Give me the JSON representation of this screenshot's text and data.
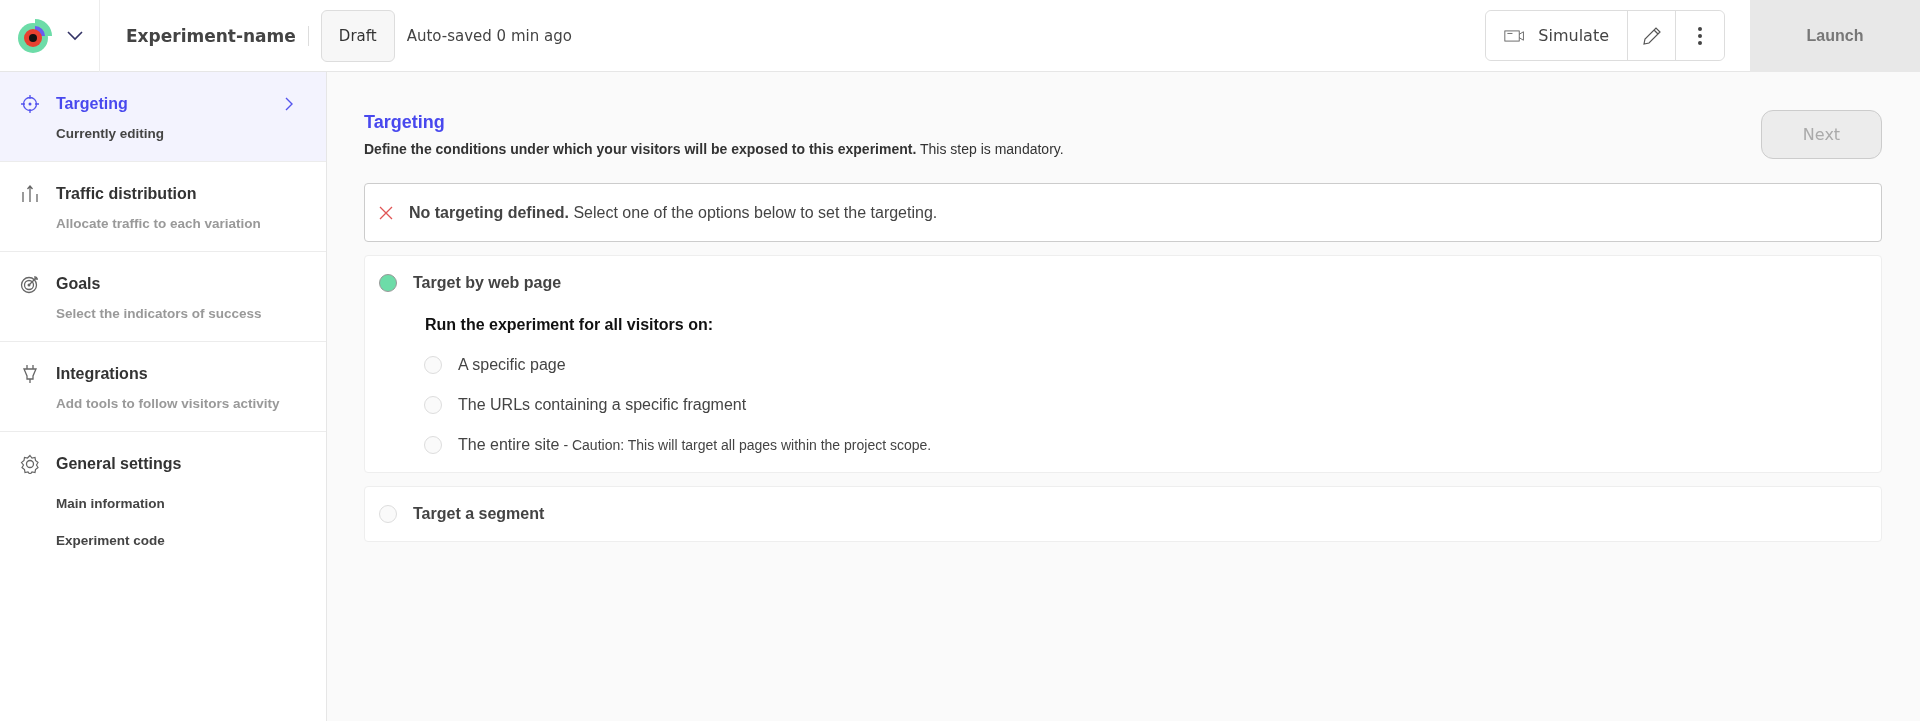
{
  "header": {
    "experiment_name": "Experiment-name",
    "status": "Draft",
    "autosave": "Auto-saved 0 min ago",
    "simulate": "Simulate",
    "launch": "Launch"
  },
  "sidebar": {
    "items": [
      {
        "kind": "targeting",
        "title": "Targeting",
        "subtitle": "Currently editing",
        "selected": true
      },
      {
        "kind": "traffic",
        "title": "Traffic distribution",
        "subtitle": "Allocate traffic to each variation",
        "selected": false
      },
      {
        "kind": "goals",
        "title": "Goals",
        "subtitle": "Select the indicators of success",
        "selected": false
      },
      {
        "kind": "integrations",
        "title": "Integrations",
        "subtitle": "Add tools to follow visitors activity",
        "selected": false
      },
      {
        "kind": "settings",
        "title": "General settings",
        "links": [
          "Main information",
          "Experiment code"
        ],
        "selected": false
      }
    ]
  },
  "main": {
    "title": "Targeting",
    "description": "**Define the conditions under which your visitors will be exposed to this experiment.** This step is mandatory.",
    "next": "Next",
    "alert": "**No targeting defined.** Select one of the options below to set the targeting.",
    "options": [
      {
        "label": "Target by web page",
        "selected": true,
        "prompt": "Run the experiment for all visitors on:",
        "choices": [
          {
            "label": "A specific page",
            "selected": false
          },
          {
            "label": "The URLs containing a specific fragment",
            "selected": false
          },
          {
            "label": "The entire site",
            "note": "- Caution: This will target all pages within the project scope.",
            "selected": false
          }
        ]
      },
      {
        "label": "Target a segment",
        "selected": false
      }
    ]
  }
}
